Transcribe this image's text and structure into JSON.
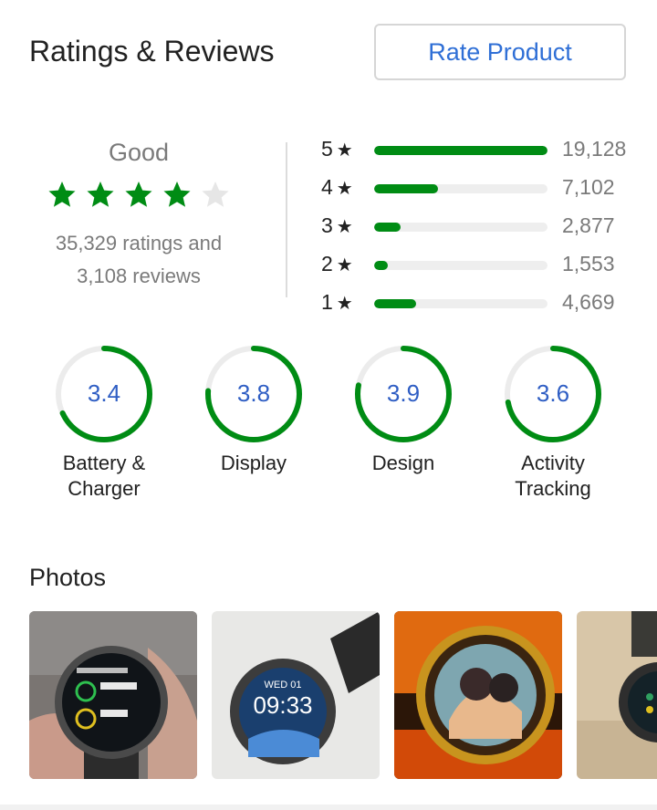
{
  "header": {
    "title": "Ratings & Reviews",
    "rate_button": "Rate Product"
  },
  "summary": {
    "label": "Good",
    "stars_filled": 4,
    "stars_total": 5,
    "ratings_line": "35,329 ratings and",
    "reviews_line": "3,108 reviews"
  },
  "distribution": [
    {
      "stars": "5",
      "count": "19,128",
      "fill_fraction": 1.0
    },
    {
      "stars": "4",
      "count": "7,102",
      "fill_fraction": 0.37
    },
    {
      "stars": "3",
      "count": "2,877",
      "fill_fraction": 0.15
    },
    {
      "stars": "2",
      "count": "1,553",
      "fill_fraction": 0.08
    },
    {
      "stars": "1",
      "count": "4,669",
      "fill_fraction": 0.24
    }
  ],
  "aspects": [
    {
      "value": "3.4",
      "label_line1": "Battery &",
      "label_line2": "Charger"
    },
    {
      "value": "3.8",
      "label_line1": "Display",
      "label_line2": ""
    },
    {
      "value": "3.9",
      "label_line1": "Design",
      "label_line2": ""
    },
    {
      "value": "3.6",
      "label_line1": "Activity",
      "label_line2": "Tracking"
    }
  ],
  "photos": {
    "title": "Photos",
    "items": [
      {
        "alt": "watch-photo-1"
      },
      {
        "alt": "watch-photo-2"
      },
      {
        "alt": "watch-photo-3"
      },
      {
        "alt": "watch-photo-4"
      }
    ]
  },
  "colors": {
    "accent_green": "#008c14",
    "link_blue": "#2f6fd6",
    "rating_blue": "#2f5ec4"
  }
}
